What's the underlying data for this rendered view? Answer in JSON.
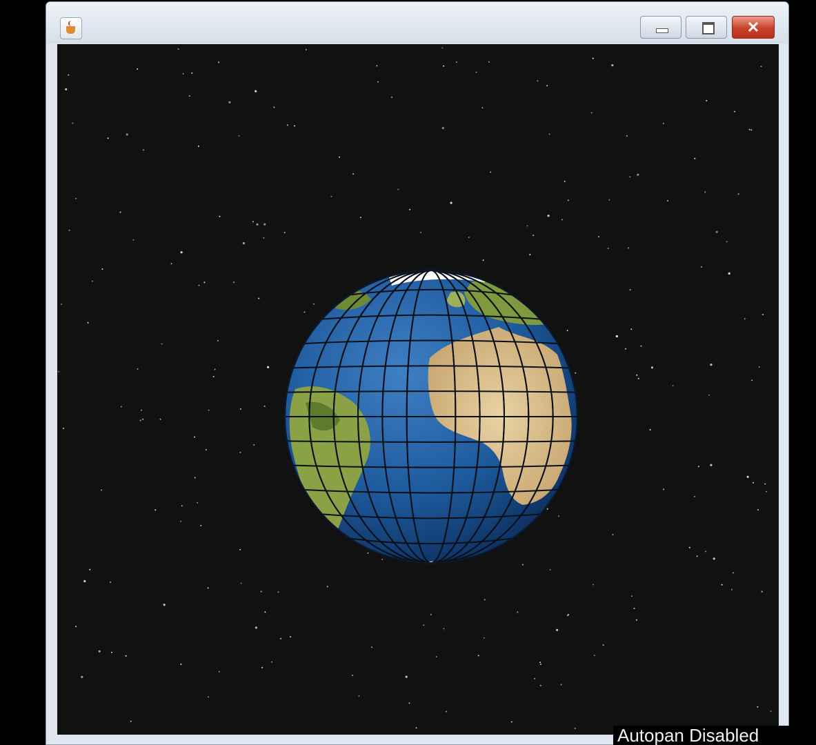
{
  "window": {
    "title": "",
    "icon": "java-cup-icon",
    "controls": [
      "minimize-icon",
      "maximize-icon",
      "close-icon"
    ]
  },
  "viewer": {
    "background": "#111111",
    "globe": "earth-globe"
  },
  "status": {
    "autopan": "Autopan Disabled"
  },
  "colors": {
    "ocean": "#1d5a9c",
    "land": "#d9bf8c",
    "vegetation": "#6f8a34",
    "ice": "#ffffff",
    "close_button": "#c8412a",
    "title_bar": "#dfe6ef"
  }
}
